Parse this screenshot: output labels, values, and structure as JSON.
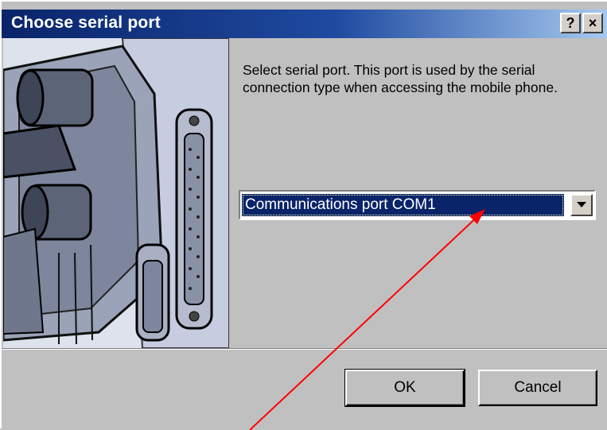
{
  "dialog": {
    "title": "Choose serial port",
    "help_button": "?",
    "close_button": "×",
    "description": "Select serial port. This port is used by the serial connection type when accessing the mobile phone.",
    "port_select": {
      "selected": "Communications port COM1"
    },
    "ok_label": "OK",
    "cancel_label": "Cancel"
  },
  "colors": {
    "title_bar": "#0a246a",
    "selection": "#0a246a",
    "annotation_arrow": "#ff0000"
  },
  "icons": [
    "help-icon",
    "close-icon",
    "dropdown-arrow-icon",
    "serial-cable-illustration"
  ]
}
